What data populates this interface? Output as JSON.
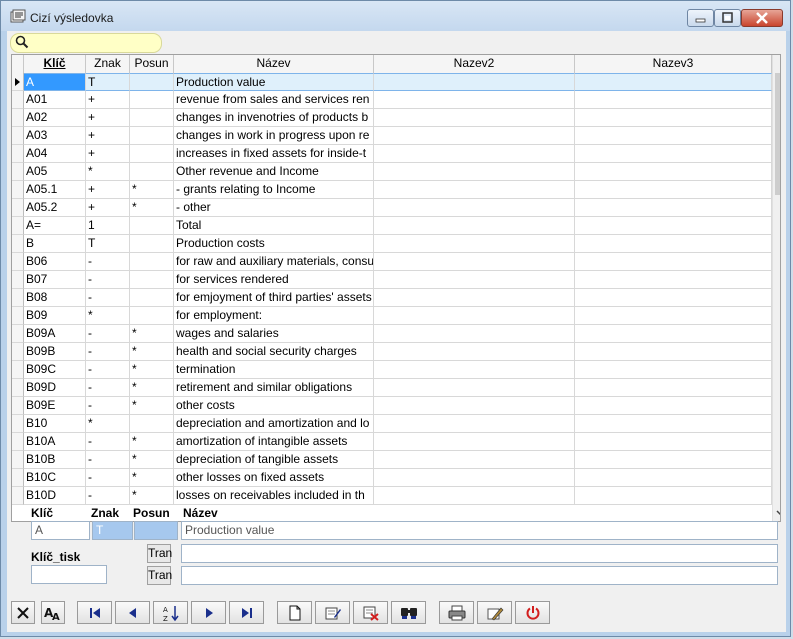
{
  "window": {
    "title": "Cizí výsledovka"
  },
  "grid": {
    "columns": [
      "Klíč",
      "Znak",
      "Posun",
      "Název",
      "Nazev2",
      "Nazev3"
    ],
    "rows": [
      {
        "key": "A",
        "znak": "T",
        "posun": "",
        "nazev": "Production value",
        "selected": true
      },
      {
        "key": "A01",
        "znak": "+",
        "posun": "",
        "nazev": "revenue from sales and services ren"
      },
      {
        "key": "A02",
        "znak": "+",
        "posun": "",
        "nazev": "changes in invenotries of products b"
      },
      {
        "key": "A03",
        "znak": "+",
        "posun": "",
        "nazev": "changes in work in progress upon re"
      },
      {
        "key": "A04",
        "znak": "+",
        "posun": "",
        "nazev": "increases in fixed assets for inside-t"
      },
      {
        "key": "A05",
        "znak": "*",
        "posun": "",
        "nazev": "Other revenue and Income"
      },
      {
        "key": "A05.1",
        "znak": "+",
        "posun": "*",
        "nazev": "- grants relating to Income"
      },
      {
        "key": "A05.2",
        "znak": "+",
        "posun": "*",
        "nazev": "- other"
      },
      {
        "key": "A=",
        "znak": "1",
        "posun": "",
        "nazev": "Total"
      },
      {
        "key": "B",
        "znak": "T",
        "posun": "",
        "nazev": "Production costs"
      },
      {
        "key": "B06",
        "znak": "-",
        "posun": "",
        "nazev": "for raw and auxiliary materials, consu"
      },
      {
        "key": "B07",
        "znak": "-",
        "posun": "",
        "nazev": "for services rendered"
      },
      {
        "key": "B08",
        "znak": "-",
        "posun": "",
        "nazev": "for emjoyment of third parties' assets"
      },
      {
        "key": "B09",
        "znak": "*",
        "posun": "",
        "nazev": "for employment:"
      },
      {
        "key": "B09A",
        "znak": "-",
        "posun": "*",
        "nazev": "wages and salaries"
      },
      {
        "key": "B09B",
        "znak": "-",
        "posun": "*",
        "nazev": "health and social security charges"
      },
      {
        "key": "B09C",
        "znak": "-",
        "posun": "*",
        "nazev": "termination"
      },
      {
        "key": "B09D",
        "znak": "-",
        "posun": "*",
        "nazev": "retirement and similar obligations"
      },
      {
        "key": "B09E",
        "znak": "-",
        "posun": "*",
        "nazev": "other costs"
      },
      {
        "key": "B10",
        "znak": "*",
        "posun": "",
        "nazev": "depreciation and amortization and lo"
      },
      {
        "key": "B10A",
        "znak": "-",
        "posun": "*",
        "nazev": "amortization of intangible assets"
      },
      {
        "key": "B10B",
        "znak": "-",
        "posun": "*",
        "nazev": "depreciation of tangible assets"
      },
      {
        "key": "B10C",
        "znak": "-",
        "posun": "*",
        "nazev": "other losses on fixed assets"
      },
      {
        "key": "B10D",
        "znak": "-",
        "posun": "*",
        "nazev": "losses on receivables included in th"
      }
    ]
  },
  "form": {
    "labels": {
      "klic": "Klíč",
      "znak": "Znak",
      "posun": "Posun",
      "nazev": "Název",
      "klic_tisk": "Klíč_tisk"
    },
    "values": {
      "klic": "A",
      "znak": "T",
      "posun": "",
      "nazev": "Production value",
      "nazev2": "",
      "nazev3": "",
      "klic_tisk": ""
    },
    "tran_label": "Tran"
  },
  "toolbar": {
    "buttons": [
      "close-icon",
      "font-icon",
      "first-record-icon",
      "prev-record-icon",
      "sort-icon",
      "next-record-icon",
      "last-record-icon",
      "new-document-icon",
      "edit-icon",
      "delete-icon",
      "find-icon",
      "print-icon",
      "tools-icon",
      "power-icon"
    ]
  },
  "colors": {
    "selection": "#3399ff",
    "search_bg": "#ffffc6",
    "navy": "#1a2f8c",
    "red": "#d21e1e"
  }
}
